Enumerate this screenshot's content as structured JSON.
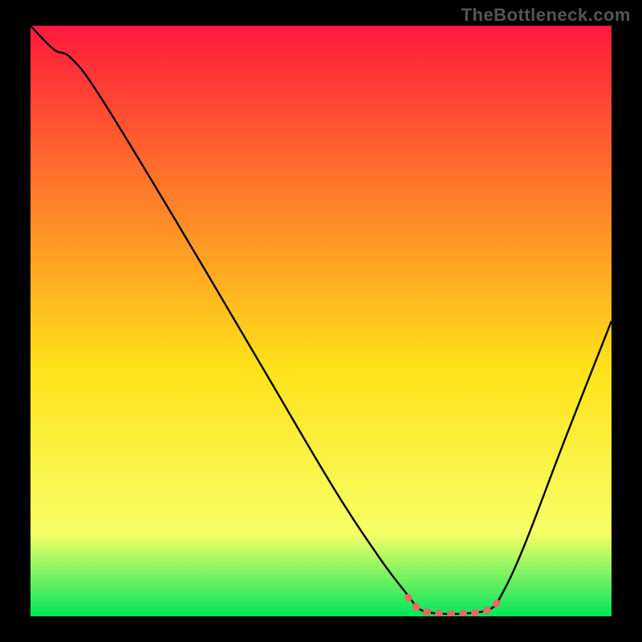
{
  "watermark": "TheBottleneck.com",
  "chart_data": {
    "type": "line",
    "title": "",
    "xlabel": "",
    "ylabel": "",
    "xlim": [
      0,
      100
    ],
    "ylim": [
      0,
      100
    ],
    "background_gradient": {
      "top": "#ff1a3c",
      "upper_mid": "#ff7a2a",
      "mid": "#ffe21a",
      "lower_mid": "#f6ff66",
      "bottom": "#00e65c"
    },
    "curve": {
      "name": "bottleneck-curve",
      "color": "#000000",
      "points": [
        {
          "x": 0,
          "y": 100
        },
        {
          "x": 4,
          "y": 96
        },
        {
          "x": 7,
          "y": 94.5
        },
        {
          "x": 12,
          "y": 88
        },
        {
          "x": 25,
          "y": 67
        },
        {
          "x": 40,
          "y": 42
        },
        {
          "x": 52,
          "y": 22
        },
        {
          "x": 60,
          "y": 10
        },
        {
          "x": 65,
          "y": 3.5
        },
        {
          "x": 67,
          "y": 1.2
        },
        {
          "x": 70,
          "y": 0.5
        },
        {
          "x": 75,
          "y": 0.5
        },
        {
          "x": 79,
          "y": 1.2
        },
        {
          "x": 81,
          "y": 3.5
        },
        {
          "x": 85,
          "y": 12
        },
        {
          "x": 92,
          "y": 30
        },
        {
          "x": 100,
          "y": 50
        }
      ]
    },
    "highlight": {
      "name": "optimal-range-marker",
      "color": "#e9695f",
      "points": [
        {
          "x": 65,
          "y": 3.2
        },
        {
          "x": 67,
          "y": 1.2
        },
        {
          "x": 70,
          "y": 0.5
        },
        {
          "x": 75,
          "y": 0.5
        },
        {
          "x": 79,
          "y": 1.2
        },
        {
          "x": 81,
          "y": 3.2
        }
      ]
    }
  }
}
